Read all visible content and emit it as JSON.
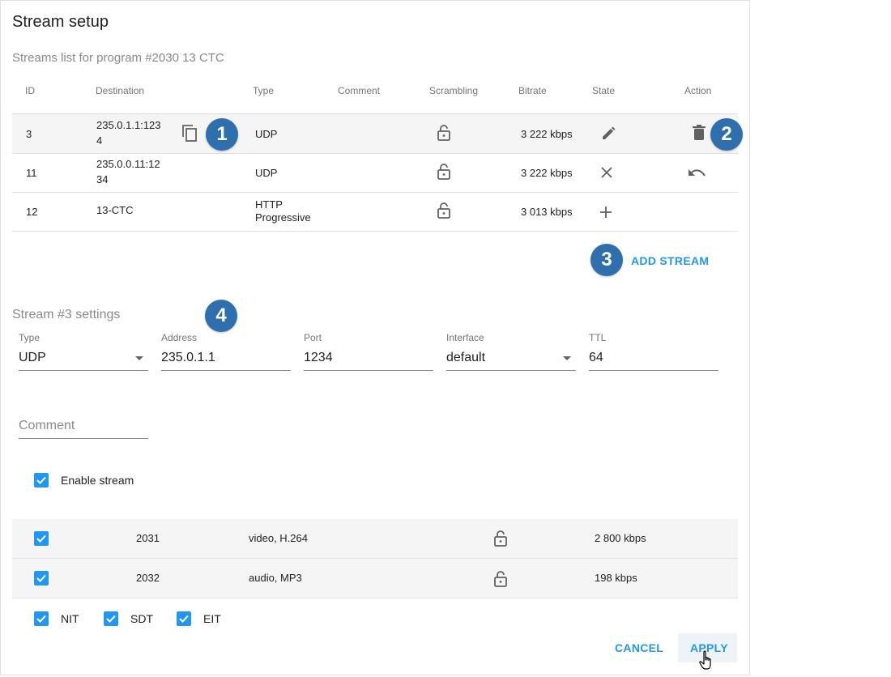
{
  "dialog": {
    "title": "Stream setup",
    "subtitle": "Streams list for program #2030 13 CTC"
  },
  "table": {
    "headers": {
      "id": "ID",
      "destination": "Destination",
      "type": "Type",
      "comment": "Comment",
      "scrambling": "Scrambling",
      "bitrate": "Bitrate",
      "state": "State",
      "action": "Action"
    },
    "rows": [
      {
        "id": "3",
        "dest1": "235.0.1.1:123",
        "dest2": "4",
        "type1": "UDP",
        "type2": "",
        "bitrate": "3 222 kbps",
        "state_icon": "pencil-icon",
        "action_icon": "trash-icon"
      },
      {
        "id": "11",
        "dest1": "235.0.0.11:12",
        "dest2": "34",
        "type1": "UDP",
        "type2": "",
        "bitrate": "3 222 kbps",
        "state_icon": "close-icon",
        "action_icon": "undo-icon"
      },
      {
        "id": "12",
        "dest1": "13-CTC",
        "dest2": "",
        "type1": "HTTP",
        "type2": "Progressive",
        "bitrate": "3 013 kbps",
        "state_icon": "plus-icon",
        "action_icon": ""
      }
    ]
  },
  "add_stream_label": "ADD STREAM",
  "callouts": [
    "1",
    "2",
    "3",
    "4"
  ],
  "settings": {
    "title": "Stream #3 settings",
    "type": {
      "label": "Type",
      "value": "UDP"
    },
    "address": {
      "label": "Address",
      "value": "235.0.1.1"
    },
    "port": {
      "label": "Port",
      "value": "1234"
    },
    "interface": {
      "label": "Interface",
      "value": "default"
    },
    "ttl": {
      "label": "TTL",
      "value": "64"
    },
    "comment": {
      "placeholder": "Comment"
    },
    "enable_label": "Enable stream",
    "enable_checked": true
  },
  "pids": [
    {
      "pid": "2031",
      "desc": "video, H.264",
      "bitrate": "2 800 kbps",
      "checked": true
    },
    {
      "pid": "2032",
      "desc": "audio, MP3",
      "bitrate": "198 kbps",
      "checked": true
    }
  ],
  "tables_flags": [
    {
      "label": "NIT",
      "checked": true
    },
    {
      "label": "SDT",
      "checked": true
    },
    {
      "label": "EIT",
      "checked": true
    }
  ],
  "footer": {
    "cancel_label": "CANCEL",
    "apply_label": "APPLY"
  },
  "colors": {
    "accent": "#2196f3",
    "callout": "#2f6fad",
    "row_highlight": "#f5f5f5"
  }
}
